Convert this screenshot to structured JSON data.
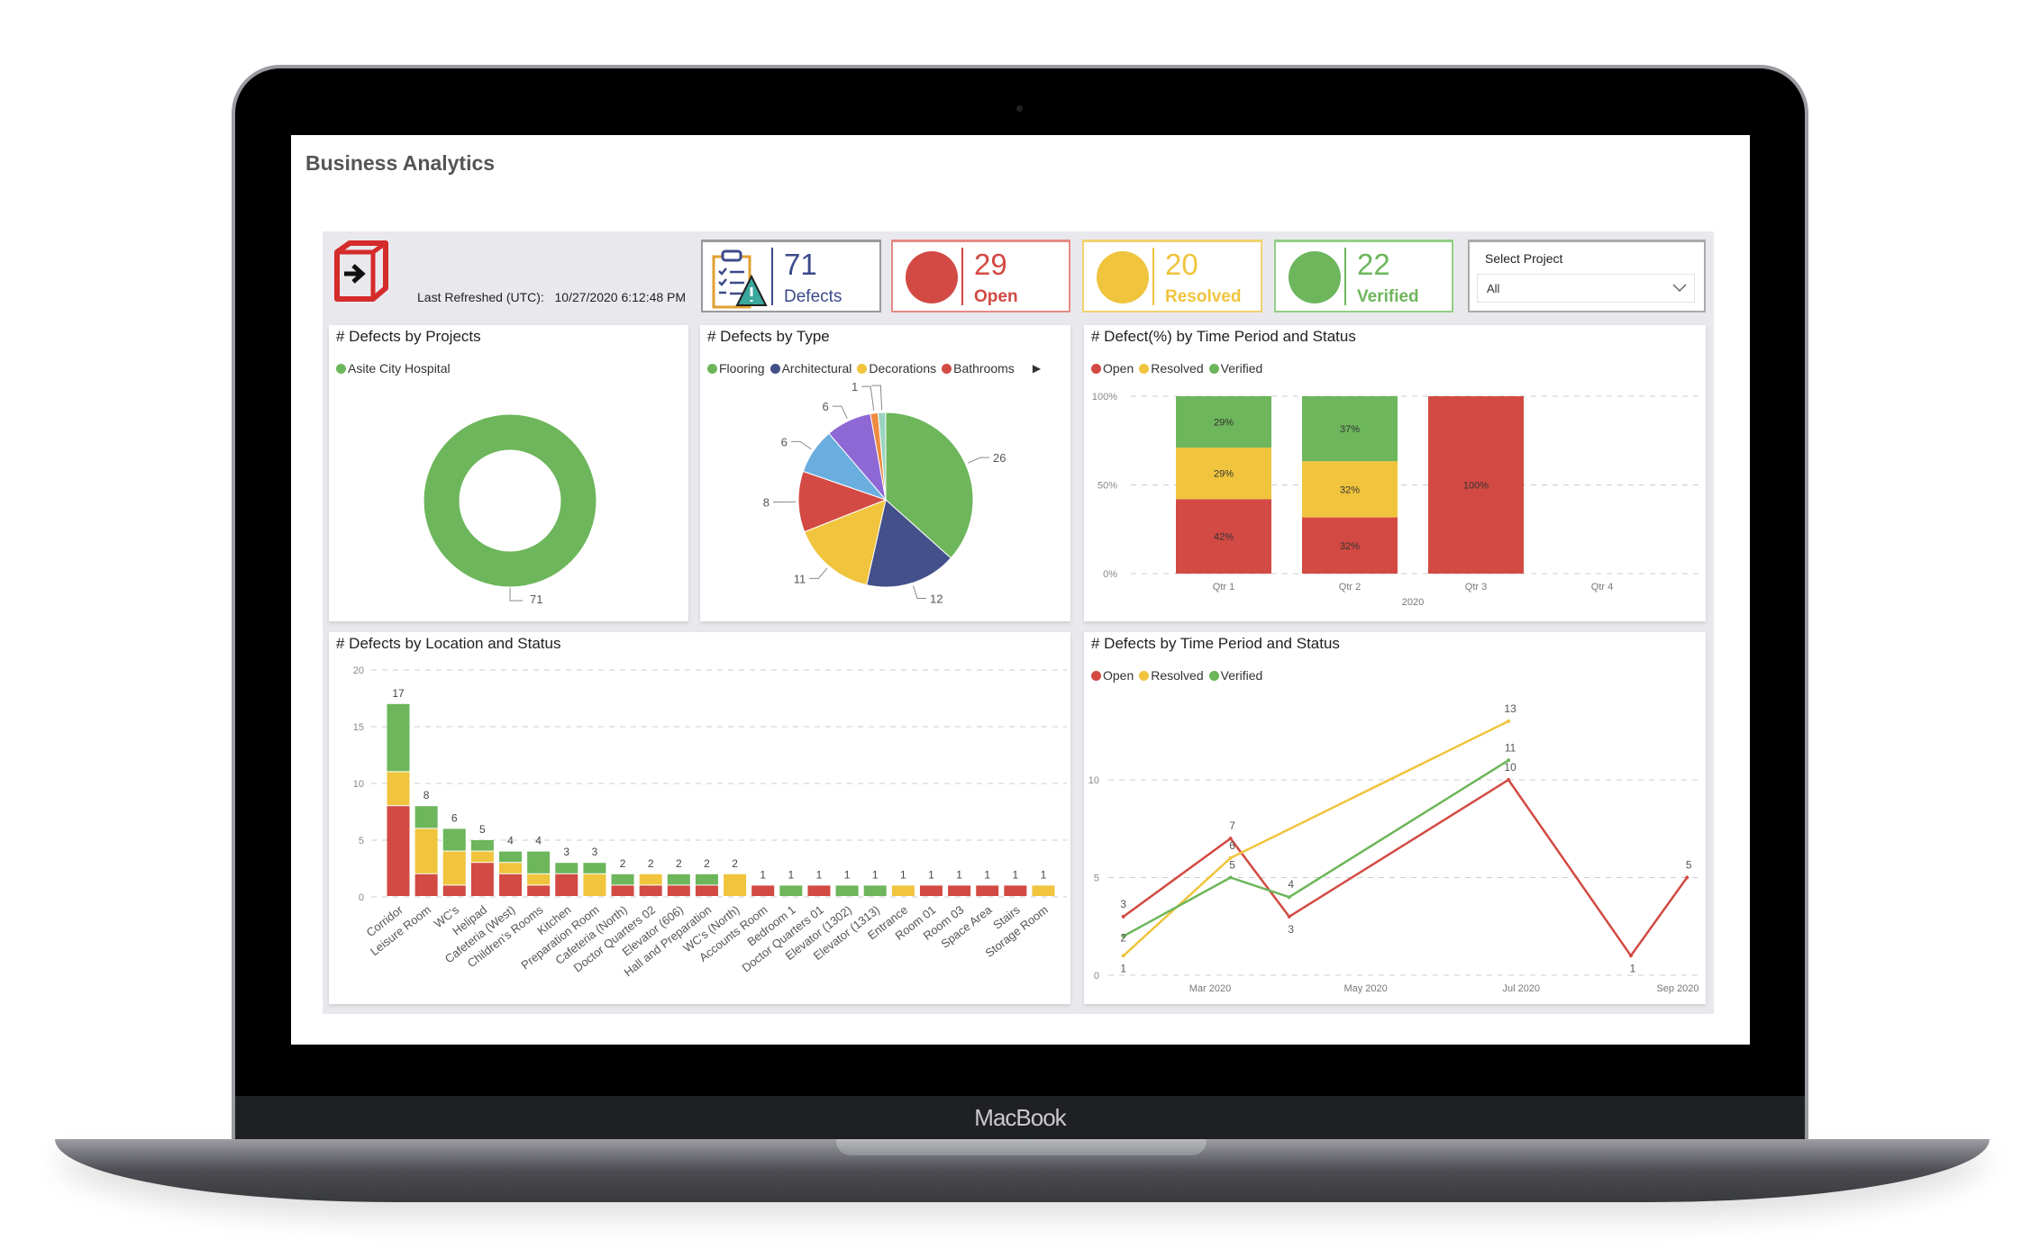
{
  "device": {
    "label": "MacBook"
  },
  "app": {
    "title": "Business Analytics"
  },
  "header": {
    "last_refreshed_label": "Last Refreshed (UTC):",
    "last_refreshed_value": "10/27/2020 6:12:48 PM",
    "logo_icon": "exit-box-icon"
  },
  "kpis": [
    {
      "value": "71",
      "label": "Defects",
      "icon": "clipboard-warning-icon",
      "color": "#3b4a8a"
    },
    {
      "value": "29",
      "label": "Open",
      "icon": "red-circle-icon",
      "color": "#d24a43"
    },
    {
      "value": "20",
      "label": "Resolved",
      "icon": "yellow-circle-icon",
      "color": "#f0c43d"
    },
    {
      "value": "22",
      "label": "Verified",
      "icon": "green-circle-icon",
      "color": "#6db65b"
    }
  ],
  "filter": {
    "label": "Select Project",
    "value": "All"
  },
  "status_colors": {
    "Open": "#d24a43",
    "Resolved": "#f0c43d",
    "Verified": "#6db65b"
  },
  "chart_data": [
    {
      "id": "projects",
      "type": "pie",
      "donut": true,
      "title": "# Defects by Projects",
      "legend": [
        "Asite City Hospital"
      ],
      "slices": [
        {
          "name": "Asite City Hospital",
          "value": 71,
          "color": "#6db65b"
        }
      ]
    },
    {
      "id": "type",
      "type": "pie",
      "title": "# Defects by Type",
      "legend": [
        "Flooring",
        "Architectural",
        "Decorations",
        "Bathrooms"
      ],
      "slices": [
        {
          "name": "Flooring",
          "value": 26,
          "color": "#6db65b"
        },
        {
          "name": "Architectural",
          "value": 12,
          "color": "#44508a"
        },
        {
          "name": "Decorations",
          "value": 11,
          "color": "#f0c43d"
        },
        {
          "name": "Bathrooms",
          "value": 8,
          "color": "#d24a43"
        },
        {
          "value": 6,
          "color": "#6aaee0"
        },
        {
          "value": 6,
          "color": "#8e68d4"
        },
        {
          "value": 1,
          "color": "#f08a40"
        },
        {
          "value": 1,
          "color": "#9ad4c0"
        }
      ]
    },
    {
      "id": "pct",
      "type": "bar",
      "stacked": "percent",
      "title": "# Defect(%) by Time Period and Status",
      "legend": [
        "Open",
        "Resolved",
        "Verified"
      ],
      "categories": [
        "Qtr 1",
        "Qtr 2",
        "Qtr 3",
        "Qtr 4"
      ],
      "group_label": "2020",
      "yticks": [
        "0%",
        "50%",
        "100%"
      ],
      "ylim": [
        0,
        100
      ],
      "grid": true,
      "series": [
        {
          "name": "Open",
          "values": [
            42,
            32,
            100,
            null
          ]
        },
        {
          "name": "Resolved",
          "values": [
            29,
            32,
            null,
            null
          ]
        },
        {
          "name": "Verified",
          "values": [
            29,
            37,
            null,
            null
          ]
        }
      ]
    },
    {
      "id": "location",
      "type": "bar",
      "stacked": true,
      "title": "# Defects by Location and Status",
      "categories": [
        "Corridor",
        "Leisure Room",
        "WC's",
        "Helipad",
        "Cafeteria (West)",
        "Children's Rooms",
        "Kitchen",
        "Preparation Room",
        "Cafeteria (North)",
        "Doctor Quarters 02",
        "Elevator (606)",
        "Hall and Preparation",
        "WC's (North)",
        "Accounts Room",
        "Bedroom 1",
        "Doctor Quarters 01",
        "Elevator (1302)",
        "Elevator (1313)",
        "Entrance",
        "Room 01",
        "Room 03",
        "Space Area",
        "Stairs",
        "Storage Room"
      ],
      "totals": [
        17,
        8,
        6,
        5,
        4,
        4,
        3,
        3,
        2,
        2,
        2,
        2,
        2,
        1,
        1,
        1,
        1,
        1,
        1,
        1,
        1,
        1,
        1,
        1
      ],
      "ylim": [
        0,
        20
      ],
      "yticks": [
        0,
        5,
        10,
        15,
        20
      ],
      "grid": true,
      "series": [
        {
          "name": "Open",
          "values": [
            8,
            2,
            1,
            3,
            2,
            1,
            2,
            0,
            1,
            1,
            1,
            1,
            0,
            1,
            0,
            1,
            0,
            0,
            0,
            1,
            1,
            1,
            1,
            0
          ]
        },
        {
          "name": "Resolved",
          "values": [
            3,
            4,
            3,
            1,
            1,
            1,
            0,
            2,
            0,
            1,
            0,
            0,
            2,
            0,
            0,
            0,
            0,
            0,
            1,
            0,
            0,
            0,
            0,
            1
          ]
        },
        {
          "name": "Verified",
          "values": [
            6,
            2,
            2,
            1,
            1,
            2,
            1,
            1,
            1,
            0,
            1,
            1,
            0,
            0,
            1,
            0,
            1,
            1,
            0,
            0,
            0,
            0,
            0,
            0
          ]
        }
      ]
    },
    {
      "id": "trend",
      "type": "line",
      "title": "# Defects by Time Period and Status",
      "legend": [
        "Open",
        "Resolved",
        "Verified"
      ],
      "xticks": [
        {
          "label": "Mar 2020",
          "date": "2020-03-01"
        },
        {
          "label": "May 2020",
          "date": "2020-05-01"
        },
        {
          "label": "Jul 2020",
          "date": "2020-07-01"
        },
        {
          "label": "Sep 2020",
          "date": "2020-09-01"
        }
      ],
      "yticks": [
        0,
        5,
        10
      ],
      "ylim": [
        0,
        13
      ],
      "grid": true,
      "series": [
        {
          "name": "Open",
          "points": [
            [
              "2020-01-27",
              3
            ],
            [
              "2020-03-09",
              7
            ],
            [
              "2020-04-01",
              3
            ],
            [
              "2020-06-26",
              10
            ],
            [
              "2020-08-13",
              1
            ],
            [
              "2020-09-04",
              5
            ]
          ]
        },
        {
          "name": "Resolved",
          "points": [
            [
              "2020-01-27",
              1
            ],
            [
              "2020-03-09",
              6
            ],
            [
              "2020-06-26",
              13
            ]
          ]
        },
        {
          "name": "Verified",
          "points": [
            [
              "2020-01-27",
              2
            ],
            [
              "2020-03-09",
              5
            ],
            [
              "2020-04-01",
              4
            ],
            [
              "2020-06-26",
              11
            ]
          ]
        }
      ]
    }
  ]
}
